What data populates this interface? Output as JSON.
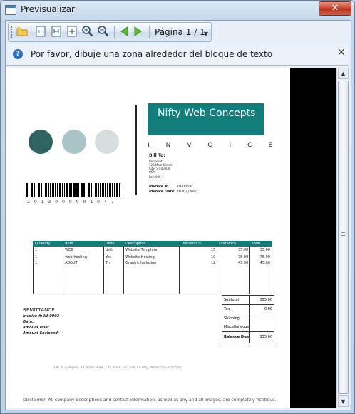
{
  "window": {
    "title": "Previsualizar",
    "close_glyph": "✕"
  },
  "toolbar": {
    "page_label": "Página 1 / 1",
    "buttons": [
      "open-folder-icon",
      "one-page-icon",
      "fit-width-icon",
      "fit-page-icon",
      "zoom-in-icon",
      "zoom-out-icon",
      "previous-page-icon",
      "next-page-icon"
    ]
  },
  "infobar": {
    "message": "Por favor, dibuje una zona alrededor del bloque de texto",
    "info_glyph": "?",
    "close_glyph": "✕"
  },
  "invoice": {
    "company": "Nifty Web Concepts",
    "title_word": "INVOICE",
    "bill_to_label": "Bill To:",
    "bill_to_lines": [
      "Recipient",
      "123 Main Street",
      "City, ST 00000",
      "USA",
      "Ref: 000-1"
    ],
    "invoice_no_label": "Invoice #:",
    "invoice_no": "IN-0003",
    "invoice_date_label": "Invoice Date:",
    "invoice_date": "01/01/2007",
    "barcode_digits": "2013000001047",
    "table_headers": [
      "Quantity",
      "Item",
      "Units",
      "Description",
      "Discount %",
      "Unit Price",
      "Total"
    ],
    "rows": [
      [
        "1",
        "WEB",
        "Unit",
        "Website Template",
        "15",
        "35.00",
        "35.00"
      ],
      [
        "1",
        "web-hosting",
        "Yes",
        "Website Hosting",
        "10",
        "75.00",
        "75.00"
      ],
      [
        "1",
        "ABOUT",
        "Tn",
        "Graphic Inclusion",
        "12",
        "45.00",
        "45.00"
      ]
    ],
    "totals": [
      {
        "label": "Subtotal",
        "value": "155.00"
      },
      {
        "label": "Tax",
        "value": "0.00"
      },
      {
        "label": "Shipping",
        "value": ""
      },
      {
        "label": "Miscellaneous",
        "value": ""
      },
      {
        "label": "Balance Due",
        "value": "155.00"
      }
    ],
    "remittance_title": "REMITTANCE",
    "remittance_lines": [
      "Invoice #: IN-0003",
      "Date:",
      "Amount Due:",
      "Amount Enclosed:"
    ],
    "footer_line": "1 W. St. Company, 12, Some Street, City, State, Zip Code, Country, Phone: 555-555-5555",
    "disclaimer": "Disclaimer: All company descriptions and contact information, as well as any and all images, are completely fictitious."
  },
  "colors": {
    "teal": "#117e7b",
    "circle1": "#2f6462",
    "circle2": "#a9c3c6",
    "circle3": "#d6dedf"
  }
}
